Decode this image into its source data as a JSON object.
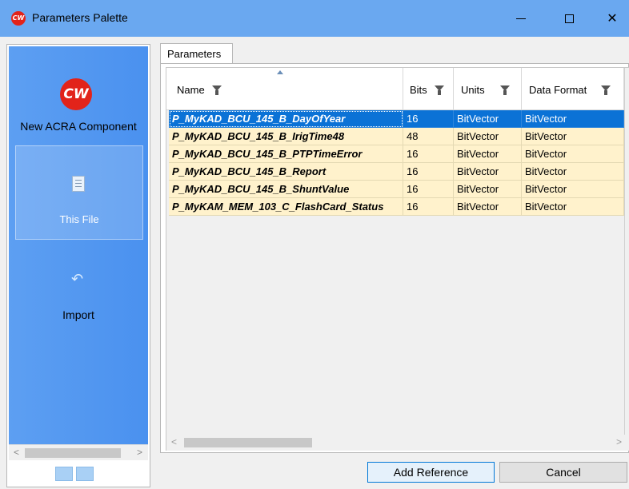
{
  "window": {
    "title": "Parameters Palette",
    "logo_text": "CW"
  },
  "nav": {
    "items": [
      {
        "label": "New ACRA Component",
        "logo_text": "CW"
      },
      {
        "label": "This File"
      },
      {
        "label": "Import"
      }
    ]
  },
  "tab": {
    "label": "Parameters"
  },
  "grid": {
    "columns": [
      "Name",
      "Bits",
      "Units",
      "Data Format"
    ],
    "rows": [
      {
        "name": "P_MyKAD_BCU_145_B_DayOfYear",
        "bits": "16",
        "units": "BitVector",
        "format": "BitVector"
      },
      {
        "name": "P_MyKAD_BCU_145_B_IrigTime48",
        "bits": "48",
        "units": "BitVector",
        "format": "BitVector"
      },
      {
        "name": "P_MyKAD_BCU_145_B_PTPTimeError",
        "bits": "16",
        "units": "BitVector",
        "format": "BitVector"
      },
      {
        "name": "P_MyKAD_BCU_145_B_Report",
        "bits": "16",
        "units": "BitVector",
        "format": "BitVector"
      },
      {
        "name": "P_MyKAD_BCU_145_B_ShuntValue",
        "bits": "16",
        "units": "BitVector",
        "format": "BitVector"
      },
      {
        "name": "P_MyKAM_MEM_103_C_FlashCard_Status",
        "bits": "16",
        "units": "BitVector",
        "format": "BitVector"
      }
    ],
    "selected_row": 0
  },
  "buttons": {
    "add_reference": "Add Reference",
    "cancel": "Cancel"
  },
  "colors": {
    "title_bar": "#6aa8f0",
    "nav": "#4a91ef",
    "row_bg": "#fff2cc",
    "selected": "#0b72d6"
  }
}
